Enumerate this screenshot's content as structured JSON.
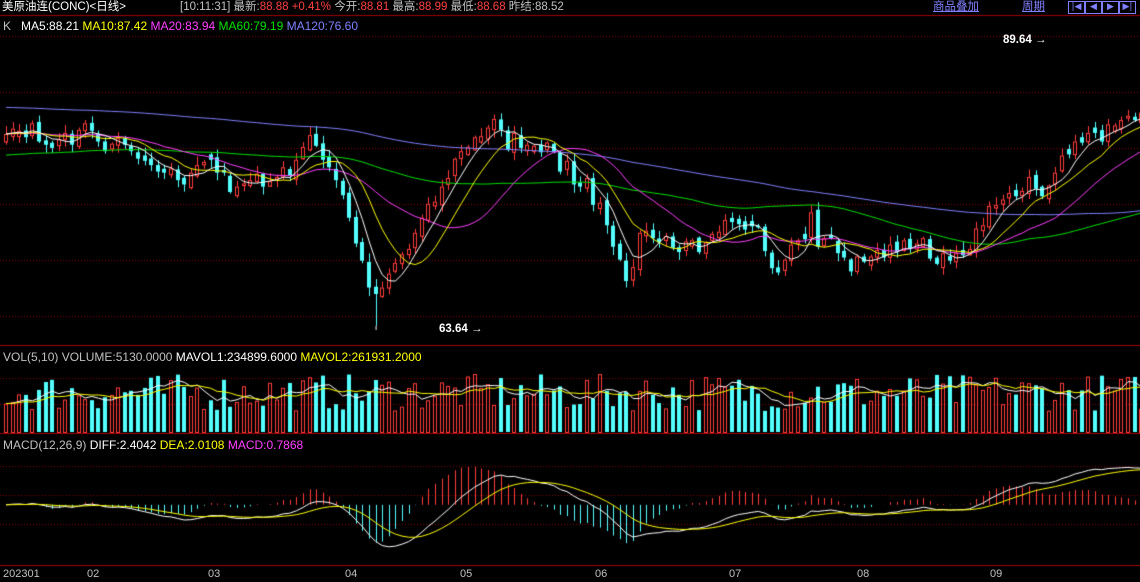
{
  "header": {
    "symbol": "美原油连(CONC)",
    "period_bracket": "<日线>",
    "time": "[10:11:31]",
    "latest_label": "最新:",
    "latest_value": "88.88",
    "change": "+0.41%",
    "open_label": "今开:",
    "open_value": "88.81",
    "high_label": "最高:",
    "high_value": "88.99",
    "low_label": "最低:",
    "low_value": "88.68",
    "prev_label": "昨结:",
    "prev_value": "88.52",
    "menu_overlay": "商品叠加",
    "menu_period": "周期",
    "nav_icons": [
      "first-page-icon",
      "prev-page-icon",
      "next-page-icon",
      "last-page-icon"
    ]
  },
  "legends": {
    "k": {
      "prefix": "K",
      "ma5": "MA5:88.21",
      "ma10": "MA10:87.42",
      "ma20": "MA20:83.94",
      "ma60": "MA60:79.19",
      "ma120": "MA120:76.60"
    },
    "vol": {
      "prefix": "VOL(5,10)",
      "volume": "VOLUME:5130.0000",
      "mavol1": "MAVOL1:234899.6000",
      "mavol2": "MAVOL2:261931.2000"
    },
    "macd": {
      "prefix": "MACD(12,26,9)",
      "diff": "DIFF:2.4042",
      "dea": "DEA:2.0108",
      "macd": "MACD:0.7868"
    }
  },
  "annotations": {
    "high_label": "89.64",
    "low_label": "63.64"
  },
  "colors": {
    "up": "#ff3c3c",
    "down": "#54ffff",
    "ma5": "#ffffff",
    "ma10": "#ffff00",
    "ma20": "#ff40ff",
    "ma60": "#00e000",
    "ma120": "#8080ff",
    "grid": "#800000"
  },
  "chart_data": {
    "type": "candlestick",
    "x_tick_labels": [
      "202301",
      "02",
      "03",
      "04",
      "05",
      "06",
      "07",
      "08",
      "09"
    ],
    "price_range": [
      62.5,
      91.0
    ],
    "closes": [
      81.5,
      82.0,
      81.8,
      81.2,
      82.5,
      80.8,
      80.5,
      80.2,
      81.0,
      81.6,
      80.5,
      81.9,
      82.5,
      81.8,
      80.8,
      79.9,
      80.6,
      81.1,
      80.5,
      79.9,
      79.2,
      79.0,
      78.6,
      78.0,
      77.9,
      78.3,
      77.2,
      76.8,
      77.9,
      78.6,
      78.9,
      79.1,
      77.9,
      77.9,
      76.1,
      76.6,
      76.9,
      77.2,
      77.8,
      76.6,
      77.1,
      77.5,
      78.4,
      77.6,
      79.1,
      80.3,
      81.4,
      80.4,
      79.1,
      78.4,
      77.2,
      75.8,
      73.7,
      71.3,
      69.7,
      67.2,
      66.6,
      67.2,
      68.5,
      69.5,
      70.3,
      70.8,
      72.3,
      73.7,
      75.0,
      75.2,
      76.6,
      77.4,
      79.2,
      79.9,
      80.3,
      81.2,
      81.3,
      82.1,
      82.9,
      81.9,
      80.0,
      81.6,
      80.2,
      80.5,
      80.4,
      79.8,
      80.7,
      79.8,
      78.0,
      79.0,
      76.8,
      76.6,
      77.4,
      74.9,
      75.1,
      73.0,
      71.0,
      69.8,
      67.8,
      69.1,
      72.3,
      72.5,
      71.8,
      71.4,
      72.0,
      70.9,
      70.5,
      71.5,
      71.6,
      70.5,
      71.4,
      72.2,
      72.4,
      73.5,
      73.3,
      73.1,
      72.6,
      72.9,
      72.8,
      70.6,
      69.0,
      68.6,
      69.8,
      71.2,
      71.6,
      71.7,
      74.2,
      71.0,
      71.8,
      71.8,
      70.4,
      70.0,
      68.7,
      70.1,
      69.6,
      70.1,
      70.7,
      70.0,
      71.2,
      70.5,
      71.6,
      70.8,
      71.3,
      71.8,
      69.9,
      69.4,
      70.4,
      69.7,
      70.4,
      70.2,
      70.8,
      72.7,
      73.0,
      74.8,
      74.9,
      75.4,
      76.0,
      75.7,
      76.2,
      77.5,
      76.4,
      75.7,
      76.7,
      77.9,
      79.5,
      79.6,
      80.8,
      80.7,
      81.6,
      81.6,
      80.8,
      82.4,
      82.3,
      82.8,
      83.2,
      82.8,
      83.5,
      84.3,
      84.6,
      83.5,
      83.1,
      81.5,
      82.0,
      81.6,
      82.4,
      81.1,
      80.9,
      81.6,
      81.3,
      81.8,
      83.1,
      84.9,
      86.8,
      87.5,
      87.8,
      87.4,
      88.4,
      88.9,
      89.2,
      88.9
    ],
    "volume_scale": [
      0,
      500000
    ],
    "macd_scale": [
      -3.9,
      3.6
    ],
    "last_values": {
      "diff": 2.4042,
      "dea": 2.0108,
      "macd": 0.7868
    }
  }
}
